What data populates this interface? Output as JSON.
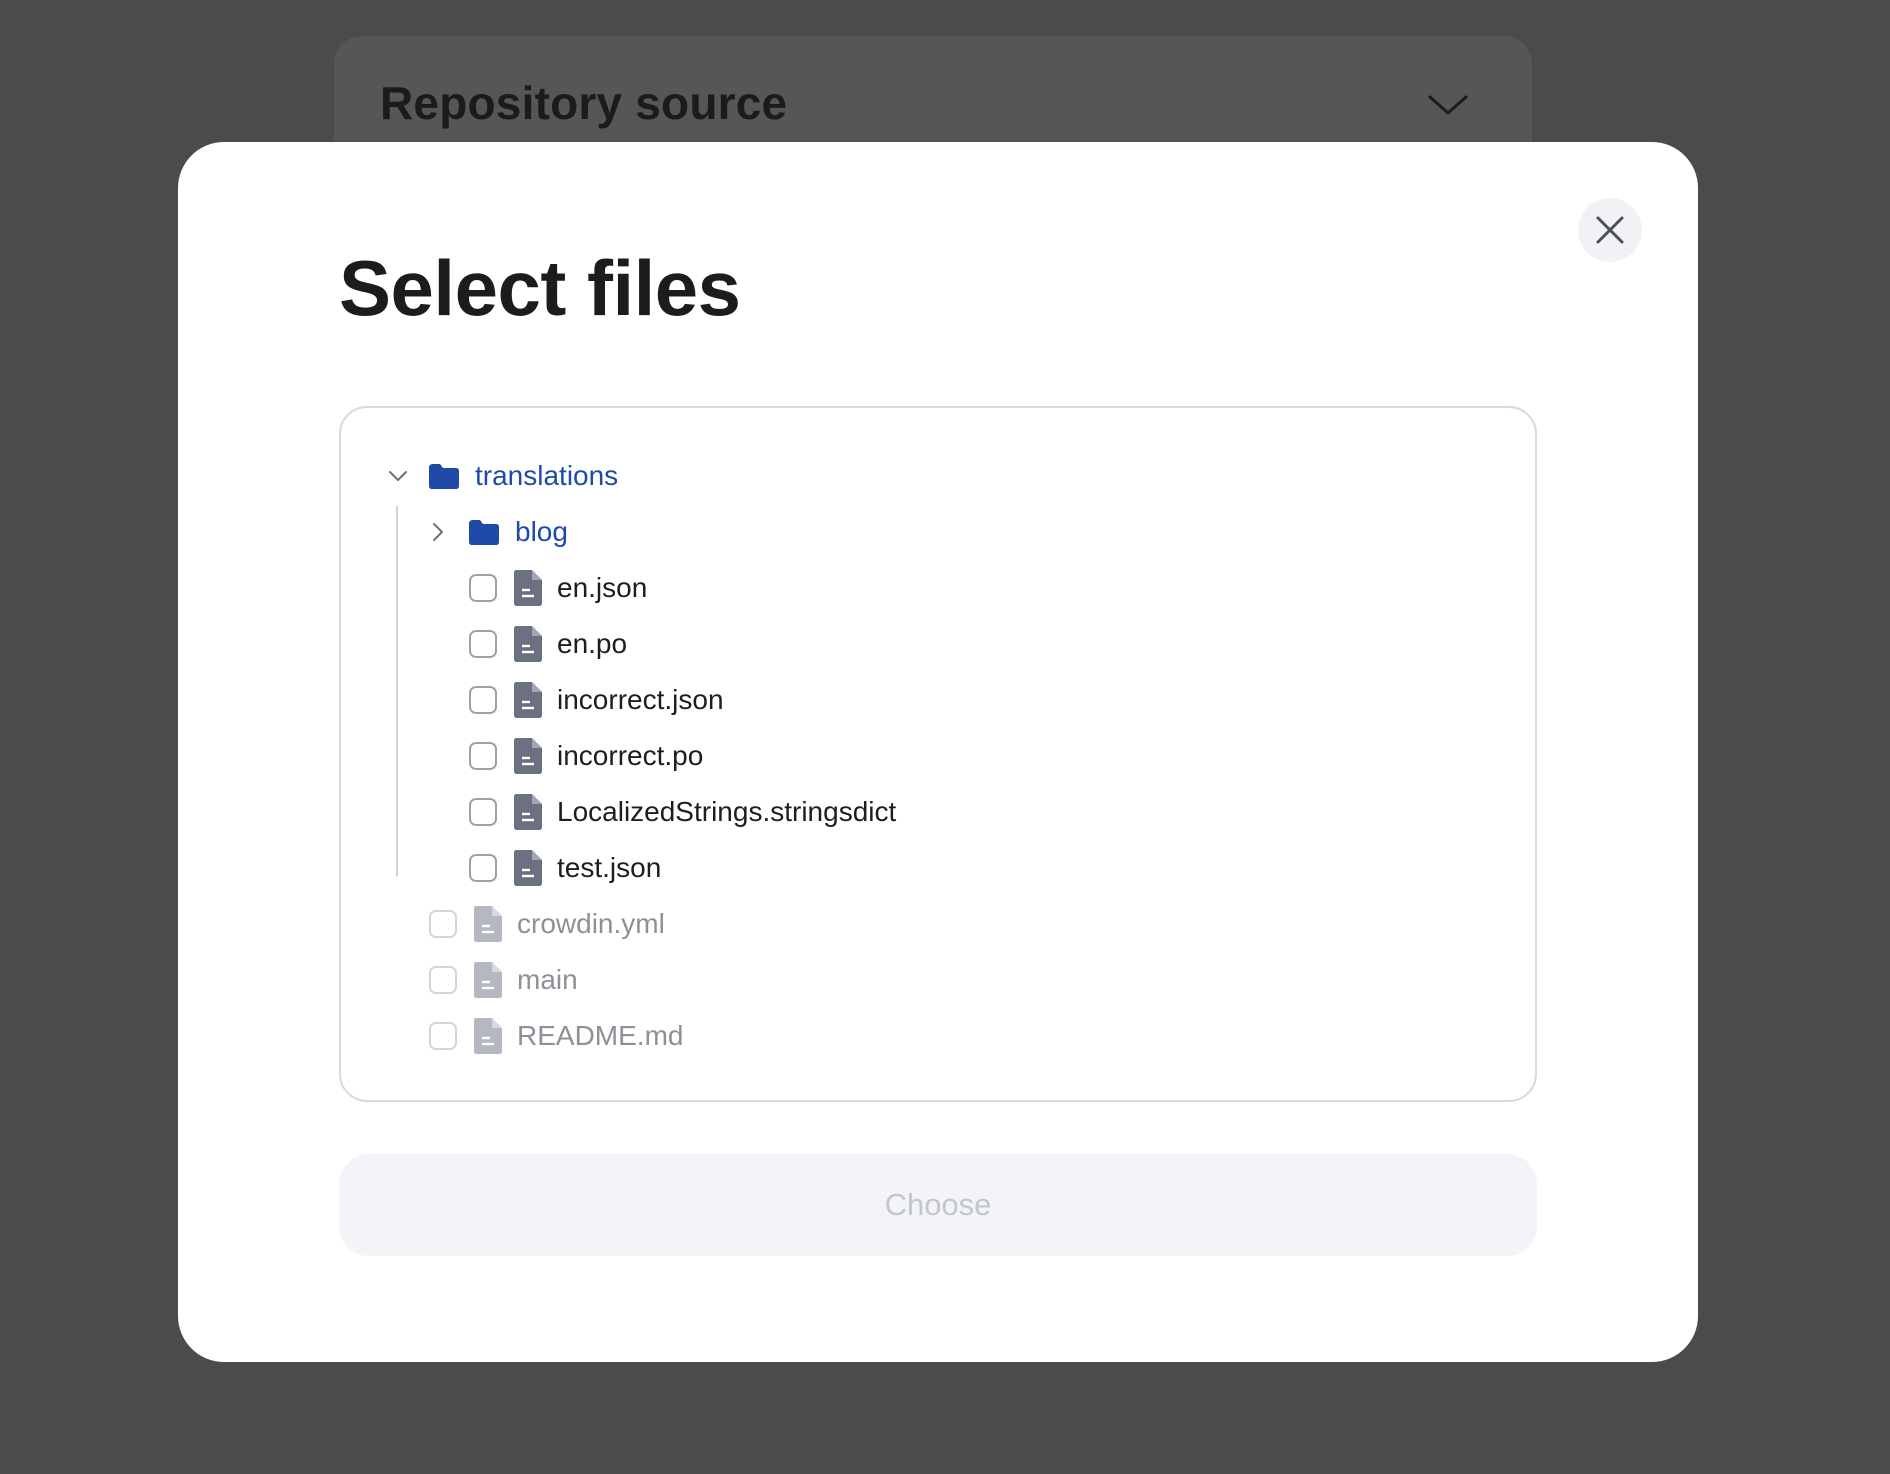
{
  "background": {
    "section_title": "Repository source",
    "chevron_icon": "chevron-down-icon"
  },
  "modal": {
    "title": "Select files",
    "close_icon": "close-icon",
    "tree": {
      "root_folder": {
        "label": "translations",
        "expanded": true,
        "toggle_icon": "chevron-down-icon",
        "icon": "folder-icon"
      },
      "subfolder": {
        "label": "blog",
        "expanded": false,
        "toggle_icon": "chevron-right-icon",
        "icon": "folder-icon"
      },
      "nested_files": [
        {
          "label": "en.json",
          "checked": false
        },
        {
          "label": "en.po",
          "checked": false
        },
        {
          "label": "incorrect.json",
          "checked": false
        },
        {
          "label": "incorrect.po",
          "checked": false
        },
        {
          "label": "LocalizedStrings.stringsdict",
          "checked": false
        },
        {
          "label": "test.json",
          "checked": false
        }
      ],
      "root_files": [
        {
          "label": "crowdin.yml",
          "checked": false,
          "disabled": true
        },
        {
          "label": "main",
          "checked": false,
          "disabled": true
        },
        {
          "label": "README.md",
          "checked": false,
          "disabled": true
        }
      ]
    },
    "choose_button": {
      "label": "Choose",
      "disabled": true
    }
  },
  "colors": {
    "overlay": "#4a4b4d",
    "folder": "#1f4aa8",
    "file_icon": "#6b7180",
    "file_icon_muted": "#b5b8c0",
    "text": "#1d1e20",
    "text_muted": "#8d9096"
  }
}
